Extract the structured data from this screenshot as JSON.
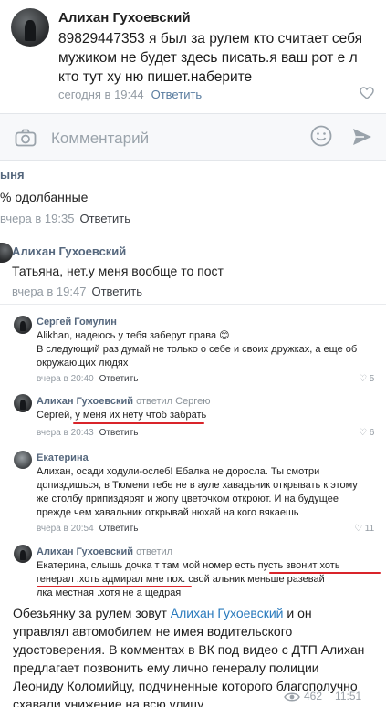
{
  "top_comment": {
    "author": "Алихан Гухоевский",
    "text": "89829447353 я был за рулем кто считает себя мужиком не будет здесь писать.я ваш рот е  л кто тут ху  ню пишет.наберите",
    "time": "сегодня в 19:44",
    "reply_label": "Ответить"
  },
  "composer": {
    "placeholder": "Комментарий"
  },
  "tatiana_comment": {
    "line1": "ыня",
    "line2": "% одолбанные",
    "time": "вчера в 19:35",
    "reply_label": "Ответить"
  },
  "alikhan_comment": {
    "author": "Алихан Гухоевский",
    "text": "Татьяна, нет.у меня вообще то пост",
    "time": "вчера в 19:47",
    "reply_label": "Ответить"
  },
  "card_comments": [
    {
      "author": "Сергей Гомулин",
      "lines": [
        "Alikhan, надеюсь у тебя заберут права 😊",
        "В следующий раз думай не только о себе и своих дружках, а еще об",
        "окружающих людях"
      ],
      "time": "вчера в 20:40",
      "reply_label": "Ответить",
      "likes": "5"
    },
    {
      "author": "Алихан Гухоевский",
      "author_sub": "ответил Сергею",
      "lines": [
        "Сергей, у меня их нету чтоб забрать"
      ],
      "time": "вчера в 20:43",
      "reply_label": "Ответить",
      "likes": "6"
    },
    {
      "author": "Екатерина",
      "lines": [
        "Алихан, осади ходули-ослеб! Ебалка не доросла. Ты смотри",
        "допиздишься, в Тюмени тебе не в ауле хавадьник открывать к этому",
        "же столбу припиздярят и жопу цветочком откроют. И на будущее",
        "прежде чем хавальник открывай нюхай на кого вякаешь"
      ],
      "time": "вчера в 20:54",
      "reply_label": "Ответить",
      "likes": "11"
    },
    {
      "author": "Алихан Гухоевский",
      "author_sub": "ответил",
      "lines": [
        "Екатерина, слышь дочка т        там мой номер есть пусть звонит хоть",
        "генерал .хоть адмирал мне пох.        свой           альник меньше разевай",
        "лка местная .хотя не        а щедрая"
      ],
      "time": "",
      "reply_label": "",
      "likes": ""
    }
  ],
  "caption": {
    "text_before": "Обезьянку за рулем зовут ",
    "link": "Алихан Гухоевский",
    "text_after": " и он управлял автомобилем не имея водительского удостоверения. В комментах в ВК под видео с ДТП Алихан предлагает позвонить ему лично генералу полиции Леониду Коломийцу, подчиненные которого благополучно схавали унижение на всю улицу.",
    "views": "462",
    "time": "11:51"
  }
}
